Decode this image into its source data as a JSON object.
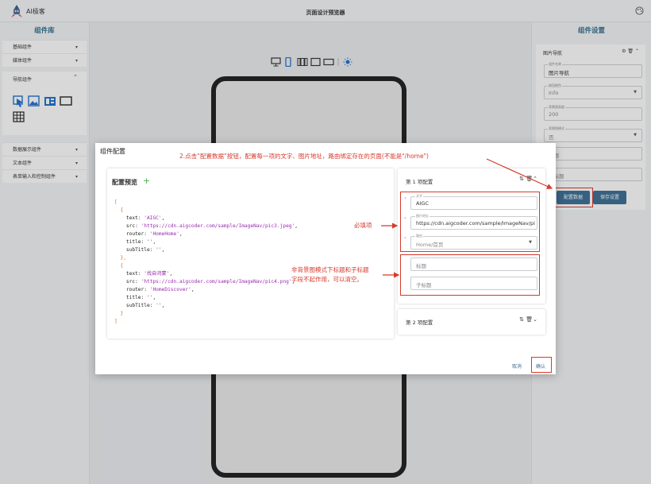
{
  "app": {
    "name": "AI极客",
    "page_title": "页面设计预览器"
  },
  "left_panel": {
    "title": "组件库",
    "groups_top": [
      {
        "label": "基础组件"
      },
      {
        "label": "媒体组件"
      }
    ],
    "nav_group": {
      "label": "导航组件"
    },
    "groups_bottom": [
      {
        "label": "数据展示组件"
      },
      {
        "label": "文本组件"
      },
      {
        "label": "表单输入和控制组件"
      }
    ]
  },
  "right_panel": {
    "title": "组件设置",
    "card_title": "图片导航",
    "fields": [
      {
        "label": "组件名称",
        "value": "图片导航"
      },
      {
        "label": "按钮颜色",
        "value": "Info"
      },
      {
        "label": "背景图高度",
        "value": "200"
      },
      {
        "label": "背景图模式",
        "value": "否"
      },
      {
        "label": "",
        "value": "标题"
      },
      {
        "label": "",
        "value": "子标题"
      }
    ],
    "config_button": "配置数据",
    "save_button": "保存设置"
  },
  "dialog": {
    "title": "组件配置",
    "preview_title": "配置预览",
    "code_lines": [
      {
        "t": "open",
        "v": "["
      },
      {
        "t": "brace",
        "v": "{"
      },
      {
        "k": "text",
        "v": "'AIGC'"
      },
      {
        "k": "src",
        "v": "'https://cdn.aigcoder.com/sample/ImageNav/pic3.jpeg'"
      },
      {
        "k": "router",
        "v": "'HomeHome'"
      },
      {
        "k": "title",
        "v": "''"
      },
      {
        "k": "subTitle",
        "v": "''"
      },
      {
        "t": "brace",
        "v": "},"
      },
      {
        "t": "brace",
        "v": "{"
      },
      {
        "k": "text",
        "v": "'找自鸿蒙'"
      },
      {
        "k": "src",
        "v": "'https://cdn.aigcoder.com/sample/ImageNav/pic4.png'"
      },
      {
        "k": "router",
        "v": "'HomeDiscover'"
      },
      {
        "k": "title",
        "v": "''"
      },
      {
        "k": "subTitle",
        "v": "''"
      },
      {
        "t": "brace",
        "v": "}"
      },
      {
        "t": "open",
        "v": "]"
      }
    ],
    "item1": {
      "title": "第 1 项配置",
      "text_label": "文字",
      "text_value": "AIGC",
      "src_label": "图片地址",
      "src_value": "https://cdn.aigcoder.com/sample/ImageNav/pic3.jpeg",
      "router_label": "路由",
      "router_value": "Home/首页",
      "title_placeholder": "标题",
      "subtitle_placeholder": "子标题"
    },
    "item2": {
      "title": "第 2 项配置"
    },
    "cancel": "取消",
    "confirm": "确认"
  },
  "annotations": {
    "top": "2.点击“配置数据”按钮，配置每一项的文字、图片地址，路由绑定存在的页面(不能是\"/home\")",
    "required": "必填项",
    "optional_line1": "非背景图模式下标题和子标题",
    "optional_line2": "字段不起作用，可以清空。",
    "color": "#d63a2d"
  },
  "colors": {
    "accent": "#3a6e95",
    "title": "#2c6e8f"
  }
}
